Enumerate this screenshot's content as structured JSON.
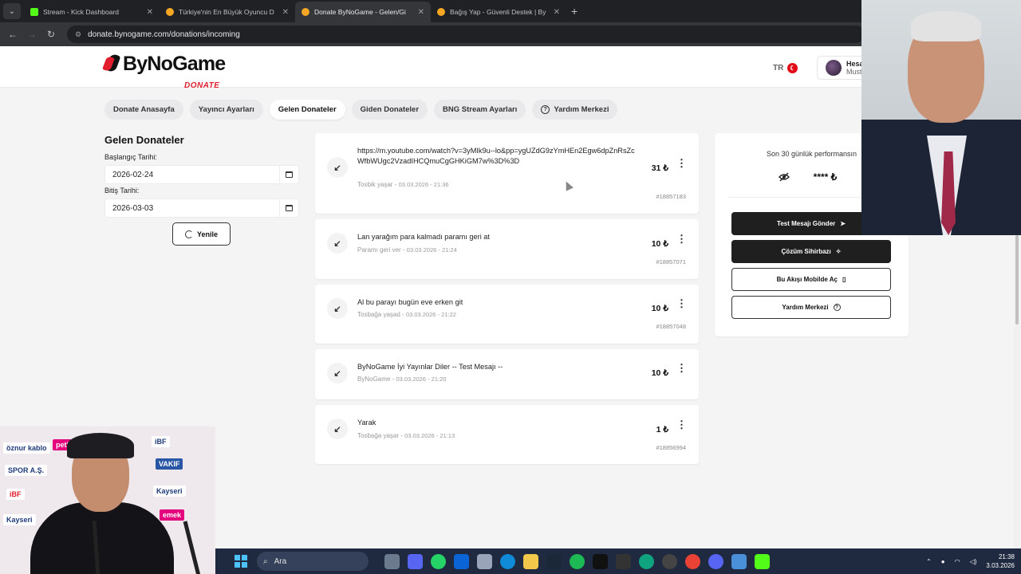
{
  "browser": {
    "tabs": [
      {
        "title": "Stream - Kick Dashboard",
        "color": "#53fc18",
        "active": false
      },
      {
        "title": "Türkiye'nin En Büyük Oyuncu D",
        "color": "#f5a623",
        "active": false
      },
      {
        "title": "Donate ByNoGame - Gelen/Gi",
        "color": "#f5a623",
        "active": true
      },
      {
        "title": "Bağış Yap - Güvenli Destek | By",
        "color": "#f5a623",
        "active": false
      }
    ],
    "url": "donate.bynogame.com/donations/incoming"
  },
  "header": {
    "logo_text": "ByNoGame",
    "logo_sub": "DONATE",
    "lang": "TR",
    "account_name": "Hesa",
    "account_sub": "Must"
  },
  "nav": {
    "items": [
      "Donate Anasayfa",
      "Yayıncı Ayarları",
      "Gelen Donateler",
      "Giden Donateler",
      "BNG Stream Ayarları",
      "Yardım Merkezi"
    ],
    "active_index": 2
  },
  "filter": {
    "title": "Gelen Donateler",
    "start_label": "Başlangıç Tarihi:",
    "start_value": "2026-02-24",
    "end_label": "Bitiş Tarihi:",
    "end_value": "2026-03-03",
    "refresh_label": "Yenile"
  },
  "donations": [
    {
      "message": "https://m.youtube.com/watch?v=3yMIk9u--lo&pp=ygUZdG9zYmHEn2Egw6dpZnRsZcWfbWUgc2VzadIHCQmuCgGHKiGM7w%3D%3D",
      "sender": "Tosbik yaşar",
      "date": "03.03.2026 - 21:36",
      "amount": "31 ₺",
      "id": "#18857183"
    },
    {
      "message": "Lan yarağım para kalmadı paramı geri at",
      "sender": "Paramı geri ver",
      "date": "03.03.2026 - 21:24",
      "amount": "10 ₺",
      "id": "#18857071"
    },
    {
      "message": "Al bu parayı bugün eve erken git",
      "sender": "Tosbağa yaşad",
      "date": "03.03.2026 - 21:22",
      "amount": "10 ₺",
      "id": "#18857048"
    },
    {
      "message": "ByNoGame İyi Yayınlar Diler -- Test Mesajı --",
      "sender": "ByNoGame",
      "date": "03.03.2026 - 21:20",
      "amount": "10 ₺",
      "id": ""
    },
    {
      "message": "Yarak",
      "sender": "Tosbağa yaşar",
      "date": "03.03.2026 - 21:13",
      "amount": "1 ₺",
      "id": "#18856994"
    }
  ],
  "performance": {
    "title": "Son 30 günlük performansın",
    "hidden_value": "**** ₺",
    "buttons": [
      "Test Mesajı Gönder",
      "Çözüm Sihirbazı",
      "Bu Akışı Mobilde Aç",
      "Yardım Merkezi"
    ]
  },
  "taskbar": {
    "search_placeholder": "Ara",
    "time": "21:38",
    "date": "3.03.2026"
  },
  "colors": {
    "brand_red": "#e11d2e",
    "dark_button": "#1f1f1f",
    "page_bg": "#f4f4f5"
  }
}
